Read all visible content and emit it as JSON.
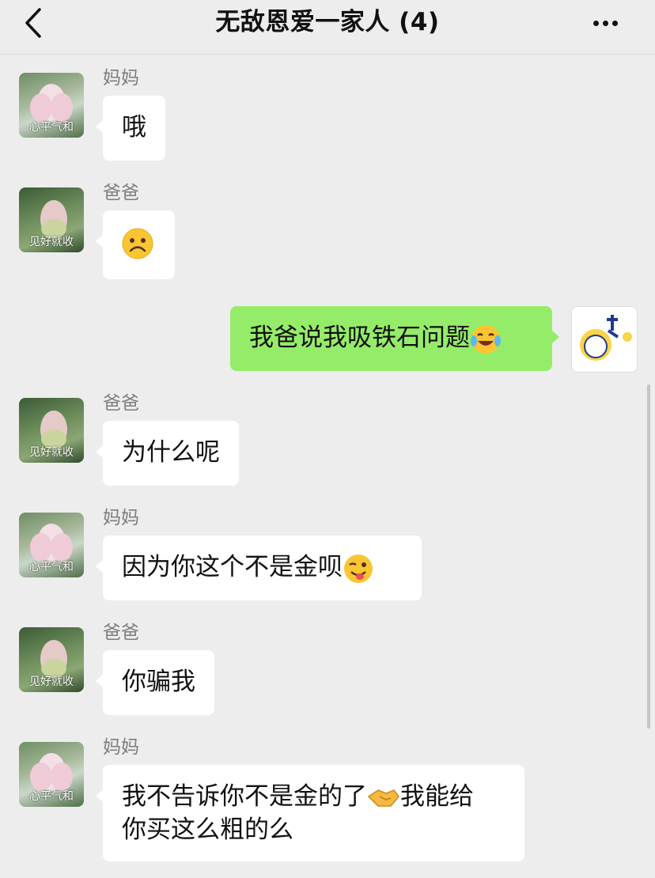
{
  "header": {
    "title": "无敌恩爱一家人 (4)"
  },
  "senders": {
    "mom": "妈妈",
    "dad": "爸爸"
  },
  "avatars": {
    "mom_caption": "心平气和",
    "dad_caption": "见好就收"
  },
  "messages": [
    {
      "from": "妈妈",
      "text": "哦"
    },
    {
      "from": "爸爸",
      "text": "",
      "emoji": "sad-face-emoji"
    },
    {
      "from": "me",
      "text": "我爸说我吸铁石问题",
      "emoji": "laugh-cry-emoji"
    },
    {
      "from": "爸爸",
      "text": "为什么呢"
    },
    {
      "from": "妈妈",
      "text": "因为你这个不是金呗",
      "emoji": "wink-tongue-emoji"
    },
    {
      "from": "爸爸",
      "text": "你骗我"
    },
    {
      "from": "妈妈",
      "text": "我不告诉你不是金的了",
      "emoji": "handshake-emoji",
      "text2": "我能给",
      "text3": "你买这么粗的么"
    }
  ],
  "colors": {
    "background": "#ededed",
    "my_bubble": "#95ec69",
    "other_bubble": "#ffffff"
  }
}
